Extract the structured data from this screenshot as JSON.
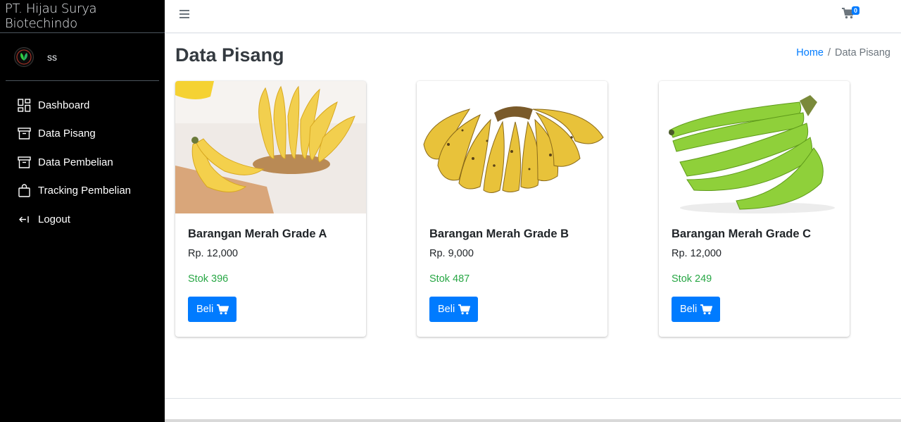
{
  "brand": {
    "title": "PT. Hijau Surya Biotechindo"
  },
  "user": {
    "name": "ss"
  },
  "sidebar": {
    "items": [
      {
        "label": "Dashboard",
        "icon": "dashboard-grid-icon"
      },
      {
        "label": "Data Pisang",
        "icon": "archive-box-icon"
      },
      {
        "label": "Data Pembelian",
        "icon": "archive-box-icon"
      },
      {
        "label": "Tracking Pembelian",
        "icon": "shopping-bag-icon"
      },
      {
        "label": "Logout",
        "icon": "logout-arrow-icon"
      }
    ]
  },
  "header": {
    "cart_count": "0"
  },
  "page": {
    "title": "Data Pisang",
    "breadcrumb": {
      "home": "Home",
      "separator": "/",
      "current": "Data Pisang"
    }
  },
  "products": [
    {
      "name": "Barangan Merah Grade A",
      "price": "Rp. 12,000",
      "stock": "Stok 396",
      "button": "Beli"
    },
    {
      "name": "Barangan Merah Grade B",
      "price": "Rp. 9,000",
      "stock": "Stok 487",
      "button": "Beli"
    },
    {
      "name": "Barangan Merah Grade C",
      "price": "Rp. 12,000",
      "stock": "Stok 249",
      "button": "Beli"
    }
  ],
  "colors": {
    "primary": "#007bff",
    "success": "#28a745",
    "sidebar": "#000000"
  }
}
